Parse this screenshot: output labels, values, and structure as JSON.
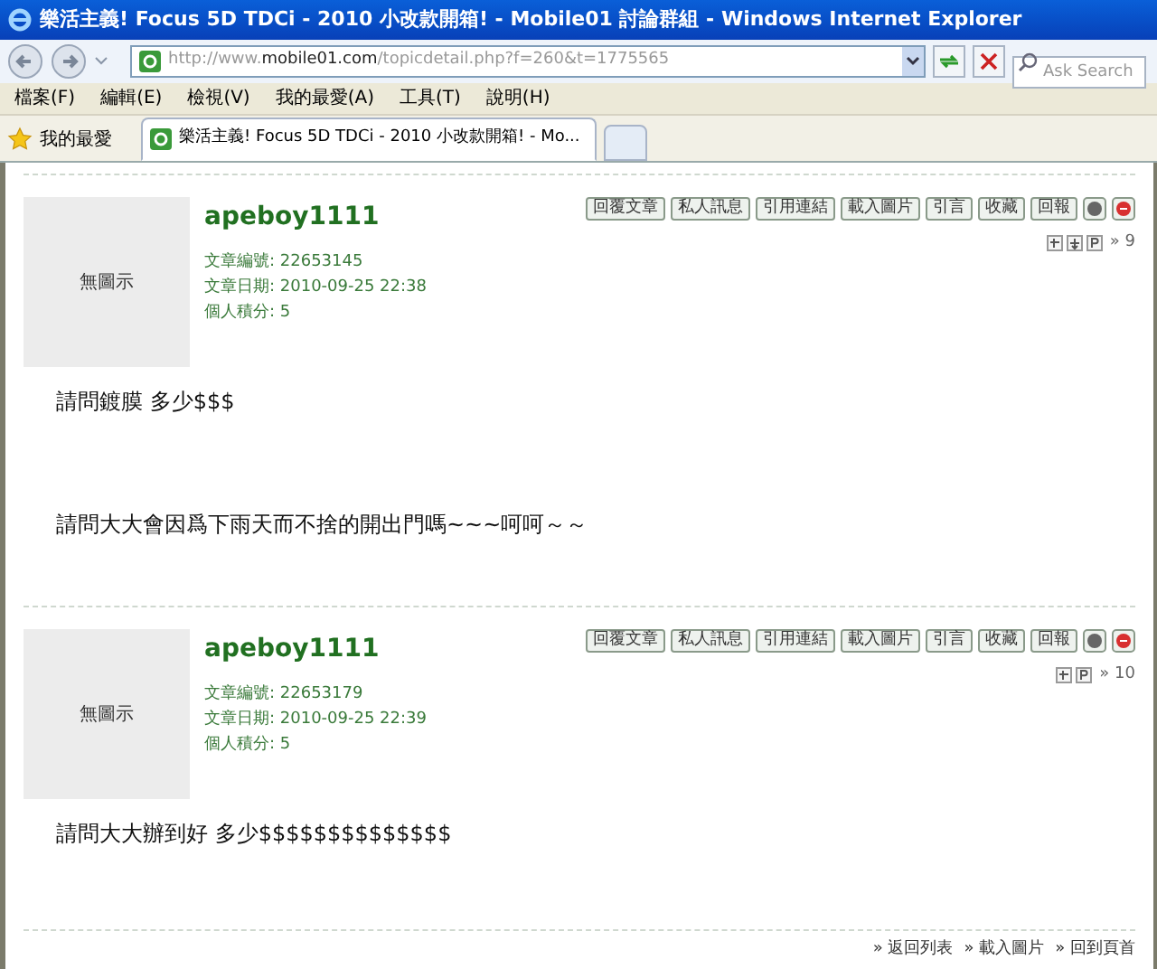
{
  "window": {
    "title": "樂活主義! Focus 5D TDCi - 2010 小改款開箱! - Mobile01 討論群組 - Windows Internet Explorer"
  },
  "address_bar": {
    "prefix": "http://www.",
    "domain": "mobile01.com",
    "path": "/topicdetail.php?f=260&t=1775565"
  },
  "search": {
    "placeholder": "Ask Search"
  },
  "menu": [
    "檔案(F)",
    "編輯(E)",
    "檢視(V)",
    "我的最愛(A)",
    "工具(T)",
    "說明(H)"
  ],
  "favorites": {
    "label": "我的最愛"
  },
  "tabs": [
    {
      "label": "樂活主義! Focus 5D TDCi - 2010 小改款開箱! - Mo...",
      "selected": true
    }
  ],
  "posts": [
    {
      "avatar": "無圖示",
      "author": "apeboy1111",
      "fields": [
        "文章編號: 22653145",
        "文章日期: 2010-09-25 22:38",
        "個人積分: 5"
      ],
      "buttons": [
        "回覆文章",
        "私人訊息",
        "引用連結",
        "載入圖片",
        "引言",
        "收藏",
        "回報"
      ],
      "nav_icons": [
        {
          "kind": "up"
        },
        {
          "kind": "down"
        },
        {
          "kind": "p"
        }
      ],
      "floor": "» 9",
      "body": [
        "請問鍍膜 多少$$$",
        "請問大大會因爲下雨天而不捨的開出門嗎~~~呵呵～～"
      ]
    },
    {
      "avatar": "無圖示",
      "author": "apeboy1111",
      "fields": [
        "文章編號: 22653179",
        "文章日期: 2010-09-25 22:39",
        "個人積分: 5"
      ],
      "buttons": [
        "回覆文章",
        "私人訊息",
        "引用連結",
        "載入圖片",
        "引言",
        "收藏",
        "回報"
      ],
      "nav_icons": [
        {
          "kind": "up"
        },
        {
          "kind": "p"
        }
      ],
      "floor": "» 10",
      "body": [
        "請問大大辦到好 多少$$$$$$$$$$$$$$"
      ]
    }
  ],
  "footer_links": [
    "» 返回列表",
    "» 載入圖片",
    "» 回到頁首"
  ]
}
